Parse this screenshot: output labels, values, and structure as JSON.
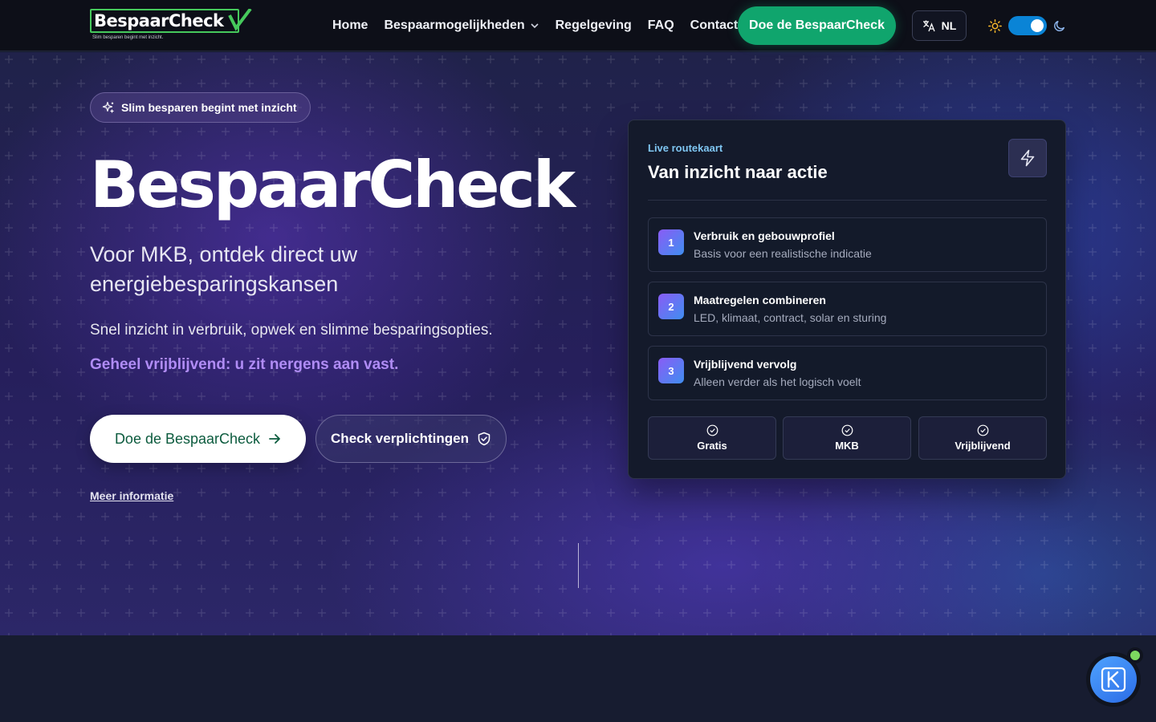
{
  "nav": {
    "logo_text": "BespaarCheck",
    "logo_tagline": "Slim besparen begint met inzicht.",
    "links": [
      {
        "label": "Home"
      },
      {
        "label": "Bespaarmogelijkheden",
        "has_dropdown": true
      },
      {
        "label": "Regelgeving"
      },
      {
        "label": "FAQ"
      },
      {
        "label": "Contact"
      }
    ],
    "cta_label": "Doe de BespaarCheck",
    "language": "NL",
    "theme_toggle_on": true
  },
  "hero": {
    "badge": "Slim besparen begint met inzicht",
    "title": "BespaarCheck",
    "subtitle": "Voor MKB, ontdek direct uw energiebesparingskansen",
    "description": "Snel inzicht in verbruik, opwek en slimme besparingsopties.",
    "note": "Geheel vrijblijvend: u zit nergens aan vast.",
    "primary_button": "Doe de BespaarCheck",
    "secondary_button": "Check verplichtingen",
    "more_link": "Meer informatie"
  },
  "route_card": {
    "eyebrow": "Live routekaart",
    "title": "Van inzicht naar actie",
    "steps": [
      {
        "num": "1",
        "title": "Verbruik en gebouwprofiel",
        "desc": "Basis voor een realistische indicatie"
      },
      {
        "num": "2",
        "title": "Maatregelen combineren",
        "desc": "LED, klimaat, contract, solar en sturing"
      },
      {
        "num": "3",
        "title": "Vrijblijvend vervolg",
        "desc": "Alleen verder als het logisch voelt"
      }
    ],
    "chips": [
      "Gratis",
      "MKB",
      "Vrijblijvend"
    ]
  },
  "colors": {
    "accent_green": "#10a56d",
    "accent_purple": "#b08cf5",
    "eyebrow_blue": "#7fc6f2",
    "toggle_blue": "#0a84d6"
  },
  "icons": [
    "sparkles-icon",
    "arrow-right-icon",
    "shield-check-icon",
    "bolt-icon",
    "check-circle-icon",
    "translate-icon",
    "sun-icon",
    "moon-icon",
    "chevron-down-icon"
  ]
}
